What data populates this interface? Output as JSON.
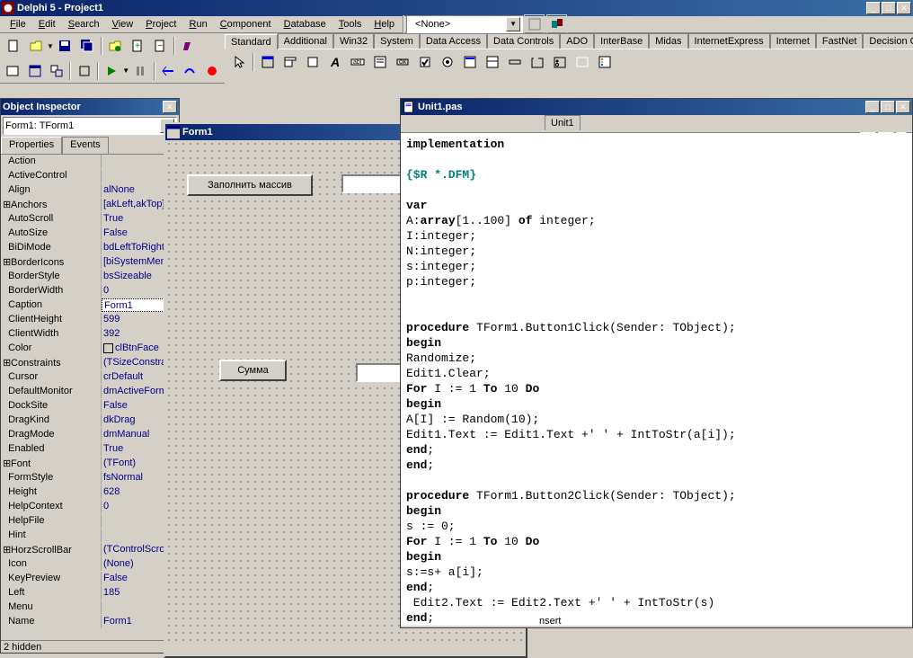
{
  "app": {
    "title": "Delphi 5 - Project1"
  },
  "menu": {
    "file": "File",
    "edit": "Edit",
    "search": "Search",
    "view": "View",
    "project": "Project",
    "run": "Run",
    "component": "Component",
    "database": "Database",
    "tools": "Tools",
    "help": "Help"
  },
  "combo_none": "<None>",
  "palette_tabs": [
    "Standard",
    "Additional",
    "Win32",
    "System",
    "Data Access",
    "Data Controls",
    "ADO",
    "InterBase",
    "Midas",
    "InternetExpress",
    "Internet",
    "FastNet",
    "Decision C..."
  ],
  "obj_inspector": {
    "title": "Object Inspector",
    "selector": "Form1: TForm1",
    "tab_props": "Properties",
    "tab_events": "Events",
    "status": "2 hidden",
    "props": [
      {
        "n": "Action",
        "v": ""
      },
      {
        "n": "ActiveControl",
        "v": ""
      },
      {
        "n": "Align",
        "v": "alNone"
      },
      {
        "n": "Anchors",
        "v": "[akLeft,akTop]",
        "exp": true
      },
      {
        "n": "AutoScroll",
        "v": "True"
      },
      {
        "n": "AutoSize",
        "v": "False"
      },
      {
        "n": "BiDiMode",
        "v": "bdLeftToRight"
      },
      {
        "n": "BorderIcons",
        "v": "[biSystemMenu",
        "exp": true
      },
      {
        "n": "BorderStyle",
        "v": "bsSizeable"
      },
      {
        "n": "BorderWidth",
        "v": "0"
      },
      {
        "n": "Caption",
        "v": "Form1",
        "sel": true
      },
      {
        "n": "ClientHeight",
        "v": "599"
      },
      {
        "n": "ClientWidth",
        "v": "392"
      },
      {
        "n": "Color",
        "v": "clBtnFace",
        "color": true
      },
      {
        "n": "Constraints",
        "v": "(TSizeConstrair",
        "exp": true
      },
      {
        "n": "Cursor",
        "v": "crDefault"
      },
      {
        "n": "DefaultMonitor",
        "v": "dmActiveForm"
      },
      {
        "n": "DockSite",
        "v": "False"
      },
      {
        "n": "DragKind",
        "v": "dkDrag"
      },
      {
        "n": "DragMode",
        "v": "dmManual"
      },
      {
        "n": "Enabled",
        "v": "True"
      },
      {
        "n": "Font",
        "v": "(TFont)",
        "exp": true
      },
      {
        "n": "FormStyle",
        "v": "fsNormal"
      },
      {
        "n": "Height",
        "v": "628"
      },
      {
        "n": "HelpContext",
        "v": "0"
      },
      {
        "n": "HelpFile",
        "v": ""
      },
      {
        "n": "Hint",
        "v": ""
      },
      {
        "n": "HorzScrollBar",
        "v": "(TControlScrollB",
        "exp": true
      },
      {
        "n": "Icon",
        "v": "(None)"
      },
      {
        "n": "KeyPreview",
        "v": "False"
      },
      {
        "n": "Left",
        "v": "185"
      },
      {
        "n": "Menu",
        "v": ""
      },
      {
        "n": "Name",
        "v": "Form1"
      }
    ]
  },
  "form_designer": {
    "title": "Form1",
    "btn1": "Заполнить массив",
    "btn2": "Сумма"
  },
  "code": {
    "title": "Unit1.pas",
    "tab": "Unit1",
    "status": "nsert",
    "lines_html": "<span class='kw'>implementation</span>\n\n<span class='dir'>{$R *.DFM}</span>\n\n<span class='kw'>var</span>\nA:<span class='kw'>array</span>[1..100] <span class='kw'>of</span> integer;\nI:integer;\nN:integer;\ns:integer;\np:integer;\n\n\n<span class='kw'>procedure</span> TForm1.Button1Click(Sender: TObject);\n<span class='kw'>begin</span>\nRandomize;\nEdit1.Clear;\n<span class='kw'>For</span> I := 1 <span class='kw'>To</span> 10 <span class='kw'>Do</span>\n<span class='kw'>begin</span>\nA[I] := Random(10);\nEdit1.Text := Edit1.Text +' ' + IntToStr(a[i]);\n<span class='kw'>end</span>;\n<span class='kw'>end</span>;\n\n<span class='kw'>procedure</span> TForm1.Button2Click(Sender: TObject);\n<span class='kw'>begin</span>\ns := 0;\n<span class='kw'>For</span> I := 1 <span class='kw'>To</span> 10 <span class='kw'>Do</span>\n<span class='kw'>begin</span>\ns:=s+ a[i];\n<span class='kw'>end</span>;\n Edit2.Text := Edit2.Text +' ' + IntToStr(s)\n<span class='kw'>end</span>;"
  }
}
